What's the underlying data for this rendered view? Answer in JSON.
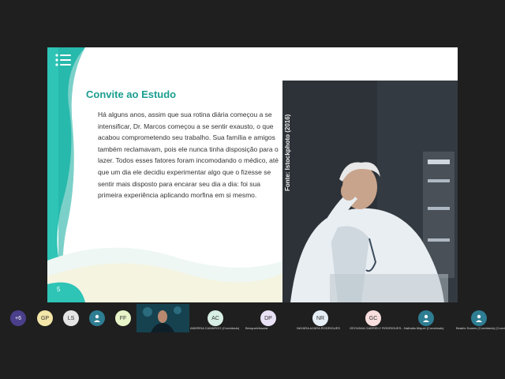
{
  "slide": {
    "title": "Convite ao Estudo",
    "body": "Há alguns anos, assim que sua rotina diária começou a se intensificar, Dr. Marcos começou a se sentir exausto, o que acabou comprometendo seu trabalho. Sua família e amigos também reclamavam, pois ele nunca tinha disposição para o lazer. Todos esses fatores foram incomodando o médico, até que um dia ele decidiu experimentar algo que o fizesse se sentir mais disposto para encarar seu dia a dia: foi sua primeira experiência aplicando morfina em si mesmo.",
    "page_number": "5",
    "photo_credit": "Fonte: Istockphoto (2016)",
    "accent_color": "#2ec4b6"
  },
  "participants": {
    "overflow_count": "+6",
    "items": [
      {
        "initials": "GP",
        "name": "",
        "color": "#f3e6a8"
      },
      {
        "initials": "LS",
        "name": "",
        "color": "#e4e4e4"
      },
      {
        "initials": "",
        "name": "",
        "icon": "user-icon",
        "color": "#2e7d92"
      },
      {
        "initials": "FF",
        "name": "",
        "color": "#e8f5c8"
      },
      {
        "initials": "AC",
        "name": "ANDREIA CAMARGO (Convidado)",
        "color": "#d8efe6"
      },
      {
        "initials": "DP",
        "name": "Benquelvfosuiar",
        "color": "#e9e1f5"
      },
      {
        "initials": "NR",
        "name": "NAYARA AZARA RODRIGUES",
        "color": "#e6eef5"
      },
      {
        "initials": "GC",
        "name": "GEOVANA GABRIELY RODRIGUES...",
        "color": "#f8dede"
      },
      {
        "initials": "",
        "name": "Nathalia Miquel (Convidado)",
        "icon": "user-icon",
        "color": "#2e7d92"
      },
      {
        "initials": "",
        "name": "Beatriz Soares (Convidado) (Convid...",
        "icon": "user-icon",
        "color": "#2e7d92"
      }
    ]
  }
}
